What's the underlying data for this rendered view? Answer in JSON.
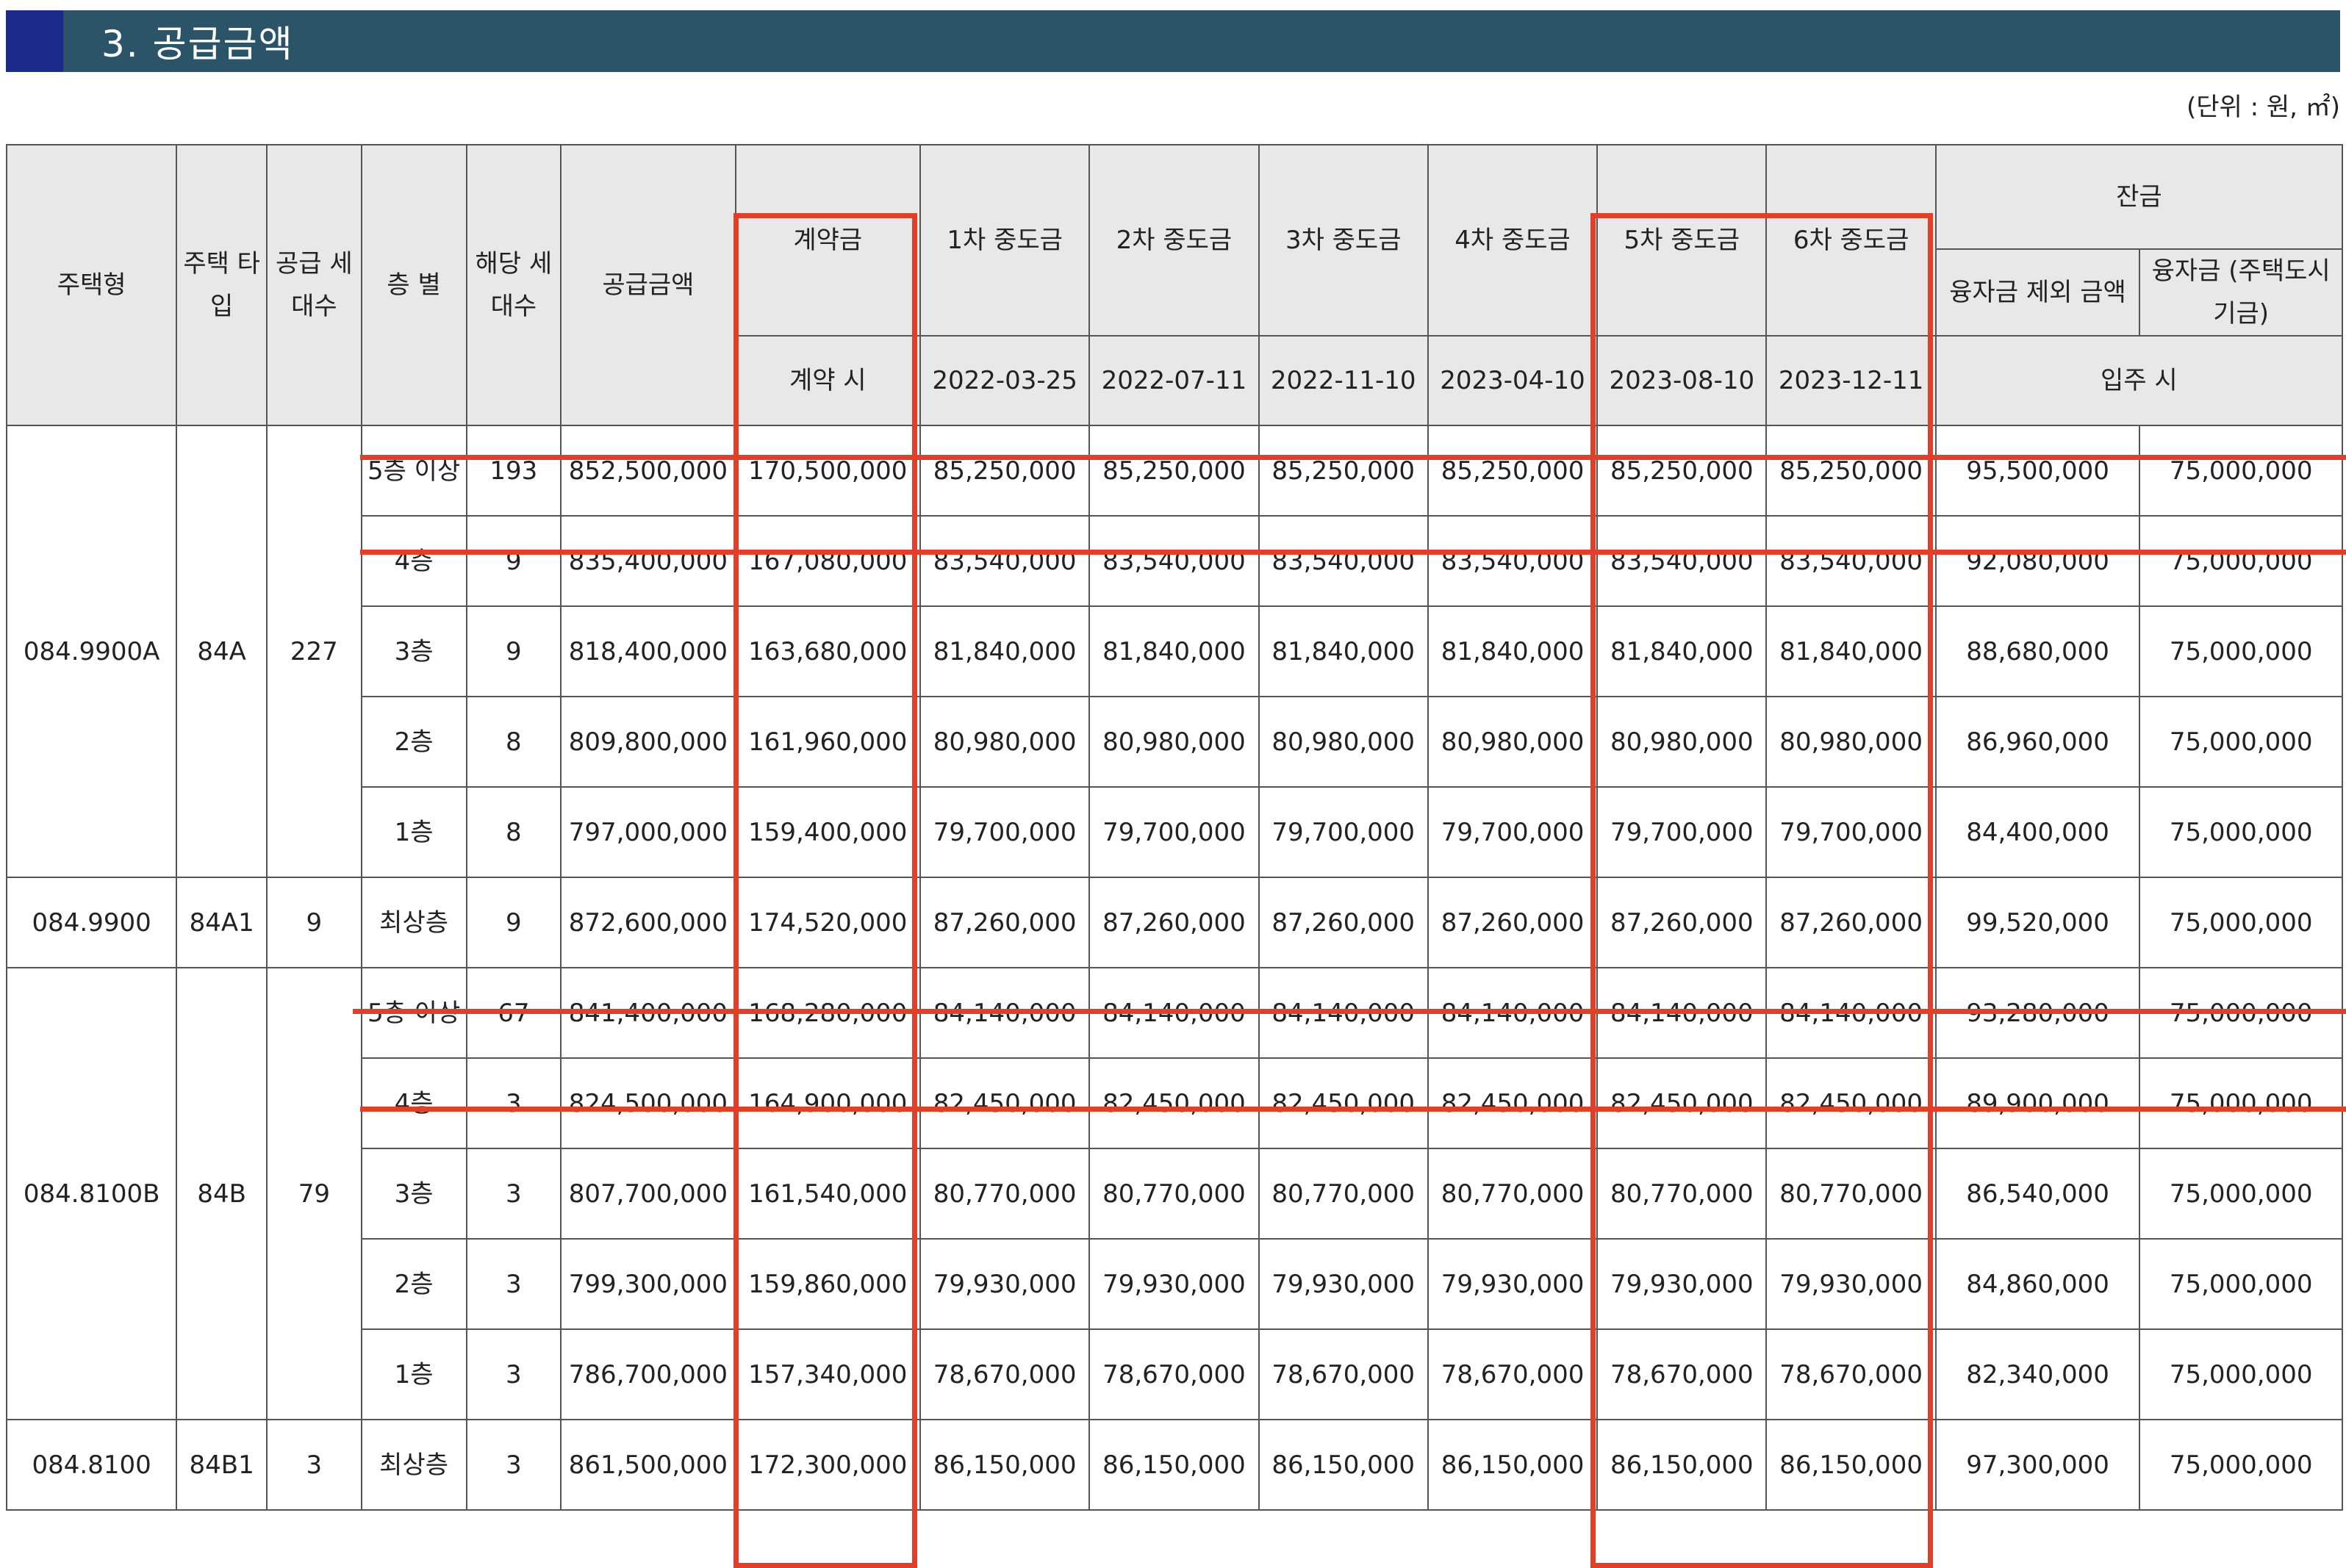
{
  "section_title": "3. 공급금액",
  "unit_note": "(단위 : 원, ㎡)",
  "headers": {
    "housing_type": "주택형",
    "housing_subtype": "주택 타입",
    "supply_units": "공급 세대수",
    "floor": "층 별",
    "units": "해당 세대수",
    "supply_price": "공급금액",
    "deposit": "계약금",
    "interim1": "1차 중도금",
    "interim2": "2차 중도금",
    "interim3": "3차 중도금",
    "interim4": "4차 중도금",
    "interim5": "5차 중도금",
    "interim6": "6차 중도금",
    "balance": "잔금",
    "balance_excl": "융자금 제외 금액",
    "balance_loan": "융자금 (주택도시기금)",
    "deposit_date": "계약 시",
    "interim1_date": "2022-03-25",
    "interim2_date": "2022-07-11",
    "interim3_date": "2022-11-10",
    "interim4_date": "2023-04-10",
    "interim5_date": "2023-08-10",
    "interim6_date": "2023-12-11",
    "balance_date": "입주 시"
  },
  "groups": [
    {
      "type": "084.9900A",
      "subtype": "84A",
      "supply": "227",
      "rows": [
        [
          "5층 이상",
          "193",
          "852,500,000",
          "170,500,000",
          "85,250,000",
          "85,250,000",
          "85,250,000",
          "85,250,000",
          "85,250,000",
          "85,250,000",
          "95,500,000",
          "75,000,000"
        ],
        [
          "4층",
          "9",
          "835,400,000",
          "167,080,000",
          "83,540,000",
          "83,540,000",
          "83,540,000",
          "83,540,000",
          "83,540,000",
          "83,540,000",
          "92,080,000",
          "75,000,000"
        ],
        [
          "3층",
          "9",
          "818,400,000",
          "163,680,000",
          "81,840,000",
          "81,840,000",
          "81,840,000",
          "81,840,000",
          "81,840,000",
          "81,840,000",
          "88,680,000",
          "75,000,000"
        ],
        [
          "2층",
          "8",
          "809,800,000",
          "161,960,000",
          "80,980,000",
          "80,980,000",
          "80,980,000",
          "80,980,000",
          "80,980,000",
          "80,980,000",
          "86,960,000",
          "75,000,000"
        ],
        [
          "1층",
          "8",
          "797,000,000",
          "159,400,000",
          "79,700,000",
          "79,700,000",
          "79,700,000",
          "79,700,000",
          "79,700,000",
          "79,700,000",
          "84,400,000",
          "75,000,000"
        ]
      ]
    },
    {
      "type": "084.9900",
      "subtype": "84A1",
      "supply": "9",
      "rows": [
        [
          "최상층",
          "9",
          "872,600,000",
          "174,520,000",
          "87,260,000",
          "87,260,000",
          "87,260,000",
          "87,260,000",
          "87,260,000",
          "87,260,000",
          "99,520,000",
          "75,000,000"
        ]
      ]
    },
    {
      "type": "084.8100B",
      "subtype": "84B",
      "supply": "79",
      "rows": [
        [
          "5층 이상",
          "67",
          "841,400,000",
          "168,280,000",
          "84,140,000",
          "84,140,000",
          "84,140,000",
          "84,140,000",
          "84,140,000",
          "84,140,000",
          "93,280,000",
          "75,000,000"
        ],
        [
          "4층",
          "3",
          "824,500,000",
          "164,900,000",
          "82,450,000",
          "82,450,000",
          "82,450,000",
          "82,450,000",
          "82,450,000",
          "82,450,000",
          "89,900,000",
          "75,000,000"
        ],
        [
          "3층",
          "3",
          "807,700,000",
          "161,540,000",
          "80,770,000",
          "80,770,000",
          "80,770,000",
          "80,770,000",
          "80,770,000",
          "80,770,000",
          "86,540,000",
          "75,000,000"
        ],
        [
          "2층",
          "3",
          "799,300,000",
          "159,860,000",
          "79,930,000",
          "79,930,000",
          "79,930,000",
          "79,930,000",
          "79,930,000",
          "79,930,000",
          "84,860,000",
          "75,000,000"
        ],
        [
          "1층",
          "3",
          "786,700,000",
          "157,340,000",
          "78,670,000",
          "78,670,000",
          "78,670,000",
          "78,670,000",
          "78,670,000",
          "78,670,000",
          "82,340,000",
          "75,000,000"
        ]
      ]
    },
    {
      "type": "084.8100",
      "subtype": "84B1",
      "supply": "3",
      "rows": [
        [
          "최상층",
          "3",
          "861,500,000",
          "172,300,000",
          "86,150,000",
          "86,150,000",
          "86,150,000",
          "86,150,000",
          "86,150,000",
          "86,150,000",
          "97,300,000",
          "75,000,000"
        ]
      ]
    }
  ],
  "highlight_color": "#e0402a"
}
